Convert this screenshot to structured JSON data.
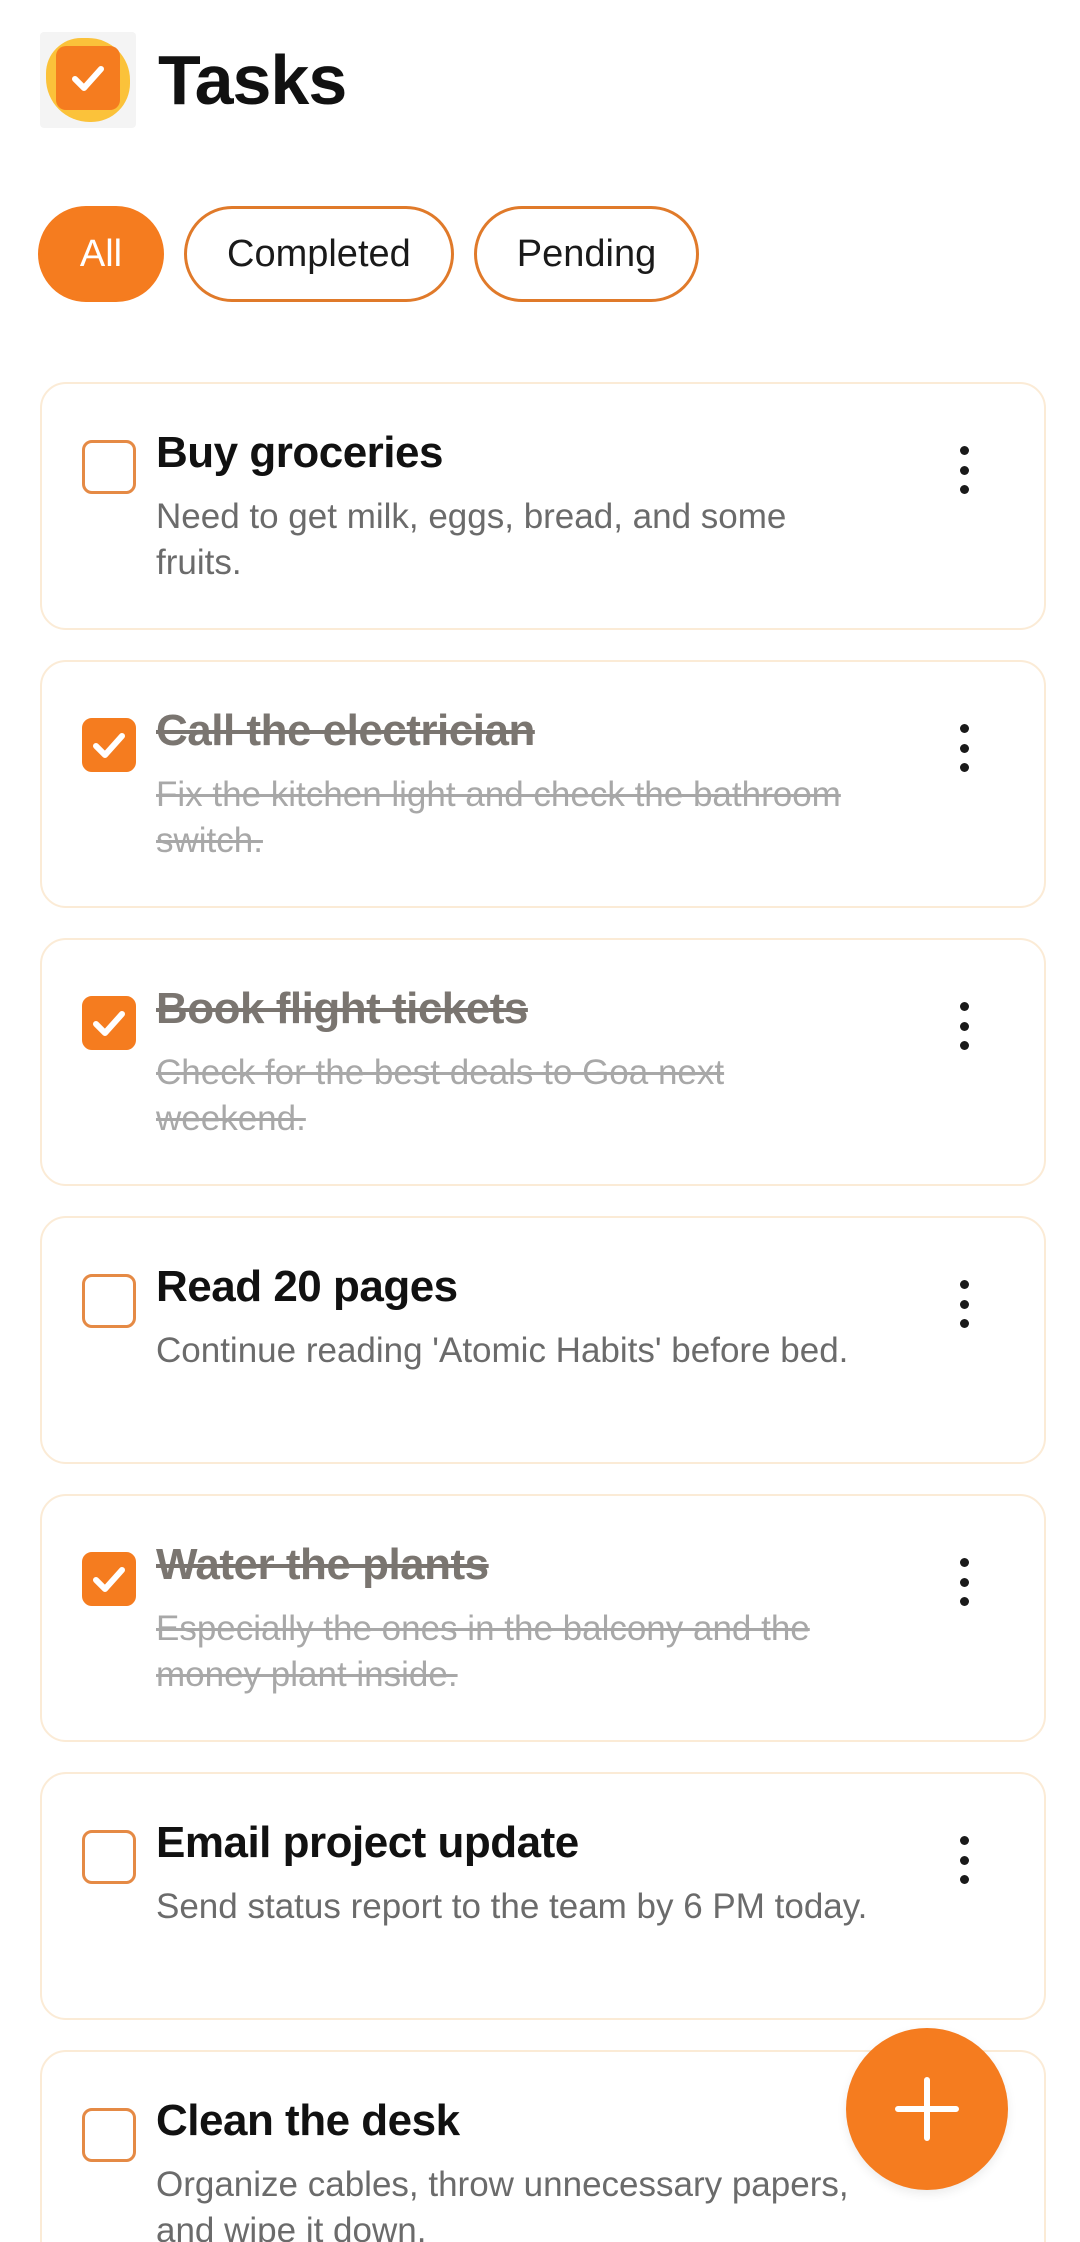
{
  "header": {
    "logo_icon": "checkmark-logo-icon",
    "title": "Tasks"
  },
  "filters": [
    {
      "label": "All",
      "active": true
    },
    {
      "label": "Completed",
      "active": false
    },
    {
      "label": "Pending",
      "active": false
    }
  ],
  "tasks": [
    {
      "title": "Buy groceries",
      "description": "Need to get milk, eggs, bread, and some fruits.",
      "completed": false
    },
    {
      "title": "Call the electrician",
      "description": "Fix the kitchen light and check the bathroom switch.",
      "completed": true
    },
    {
      "title": "Book flight tickets",
      "description": "Check for the best deals to Goa next weekend.",
      "completed": true
    },
    {
      "title": "Read 20 pages",
      "description": "Continue reading 'Atomic Habits' before bed.",
      "completed": false
    },
    {
      "title": "Water the plants",
      "description": "Especially the ones in the balcony and the money plant inside.",
      "completed": true
    },
    {
      "title": "Email project update",
      "description": "Send status report to the team by 6 PM today.",
      "completed": false
    },
    {
      "title": "Clean the desk",
      "description": "Organize cables, throw unnecessary papers, and wipe it down.",
      "completed": false
    }
  ],
  "fab": {
    "icon": "plus-icon"
  },
  "colors": {
    "accent": "#f57c1f",
    "card_border": "#fbebd6",
    "logo_glow": "#fbc23a"
  }
}
